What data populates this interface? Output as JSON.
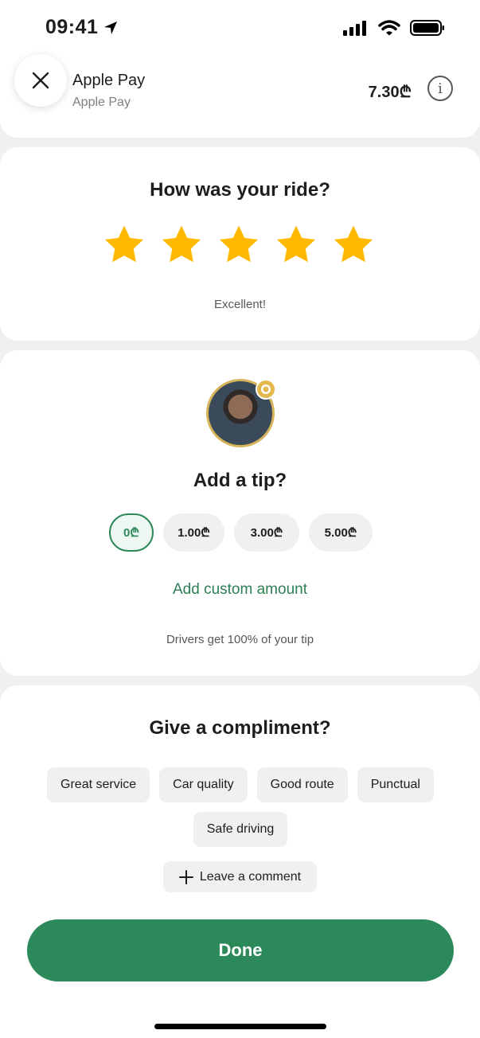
{
  "status_bar": {
    "time": "09:41"
  },
  "header": {
    "payment_title": "Apple Pay",
    "payment_subtitle": "Apple Pay",
    "amount": "7.30₾",
    "info_glyph": "i"
  },
  "rating": {
    "title": "How was your ride?",
    "stars": 5,
    "max_stars": 5,
    "label": "Excellent!"
  },
  "tip": {
    "title": "Add a tip?",
    "options": [
      "0₾",
      "1.00₾",
      "3.00₾",
      "5.00₾"
    ],
    "selected_index": 0,
    "custom_amount_label": "Add custom amount",
    "note": "Drivers get 100% of your tip"
  },
  "compliment": {
    "title": "Give a compliment?",
    "chips": [
      "Great service",
      "Car quality",
      "Good route",
      "Punctual",
      "Safe driving"
    ],
    "comment_label": "Leave a comment"
  },
  "done_label": "Done",
  "colors": {
    "accent_green": "#2c8a5a",
    "star_yellow": "#ffb800",
    "background": "#eef0f1"
  }
}
